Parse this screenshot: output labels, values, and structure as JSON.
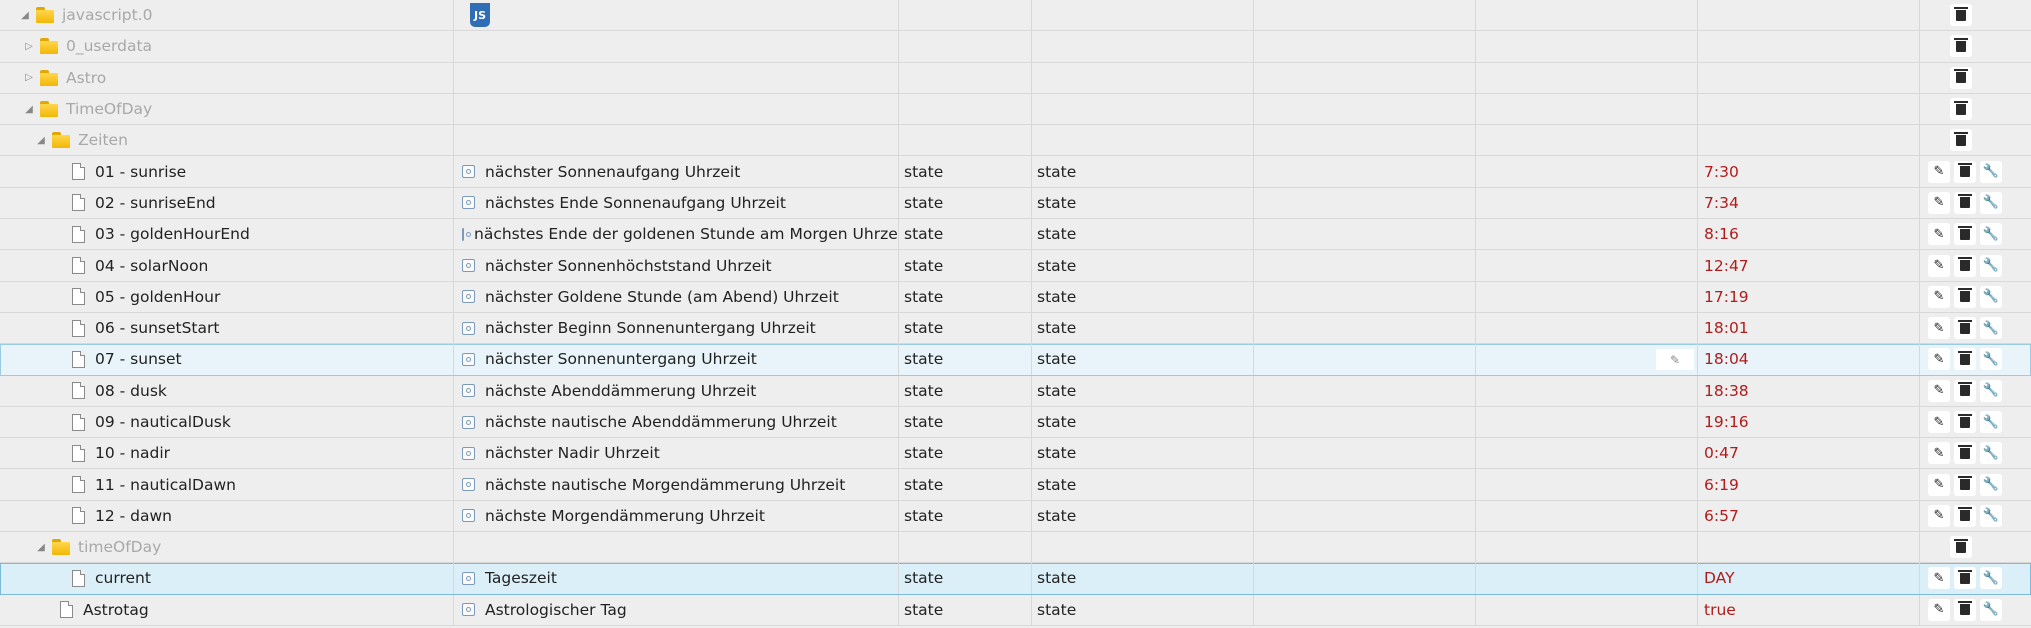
{
  "root": {
    "name": "javascript.0",
    "js_icon": "JS"
  },
  "folders": {
    "userdata": "0_userdata",
    "astro": "Astro",
    "timeofday": "TimeOfDay",
    "zeiten": "Zeiten",
    "timeofday2": "timeOfDay"
  },
  "zeiten_rows": [
    {
      "name": "01 - sunrise",
      "desc": "nächster Sonnenaufgang Uhrzeit",
      "type": "state",
      "role": "state",
      "value": "7:30"
    },
    {
      "name": "02 - sunriseEnd",
      "desc": "nächstes Ende Sonnenaufgang Uhrzeit",
      "type": "state",
      "role": "state",
      "value": "7:34"
    },
    {
      "name": "03 - goldenHourEnd",
      "desc": "nächstes Ende der goldenen Stunde am Morgen Uhrzeit",
      "type": "state",
      "role": "state",
      "value": "8:16"
    },
    {
      "name": "04 - solarNoon",
      "desc": "nächster Sonnenhöchststand Uhrzeit",
      "type": "state",
      "role": "state",
      "value": "12:47"
    },
    {
      "name": "05 - goldenHour",
      "desc": "nächster Goldene Stunde (am Abend) Uhrzeit",
      "type": "state",
      "role": "state",
      "value": "17:19"
    },
    {
      "name": "06 - sunsetStart",
      "desc": "nächster Beginn Sonnenuntergang Uhrzeit",
      "type": "state",
      "role": "state",
      "value": "18:01"
    },
    {
      "name": "07 - sunset",
      "desc": "nächster Sonnenuntergang Uhrzeit",
      "type": "state",
      "role": "state",
      "value": "18:04"
    },
    {
      "name": "08 - dusk",
      "desc": "nächste Abenddämmerung Uhrzeit",
      "type": "state",
      "role": "state",
      "value": "18:38"
    },
    {
      "name": "09 - nauticalDusk",
      "desc": "nächste nautische Abenddämmerung Uhrzeit",
      "type": "state",
      "role": "state",
      "value": "19:16"
    },
    {
      "name": "10 - nadir",
      "desc": "nächster Nadir Uhrzeit",
      "type": "state",
      "role": "state",
      "value": "0:47"
    },
    {
      "name": "11 - nauticalDawn",
      "desc": "nächste nautische Morgendämmerung Uhrzeit",
      "type": "state",
      "role": "state",
      "value": "6:19"
    },
    {
      "name": "12 - dawn",
      "desc": "nächste Morgendämmerung Uhrzeit",
      "type": "state",
      "role": "state",
      "value": "6:57"
    }
  ],
  "current_row": {
    "name": "current",
    "desc": "Tageszeit",
    "type": "state",
    "role": "state",
    "value": "DAY"
  },
  "astrotag_row": {
    "name": "Astrotag",
    "desc": "Astrologischer Tag",
    "type": "state",
    "role": "state",
    "value": "true"
  },
  "icons": {
    "edit": "pencil-icon",
    "delete": "trash-icon",
    "config": "wrench-icon"
  },
  "colors": {
    "value": "#b01c1c",
    "selected_bg": "#dbeff8",
    "folder": "#f2b705"
  }
}
